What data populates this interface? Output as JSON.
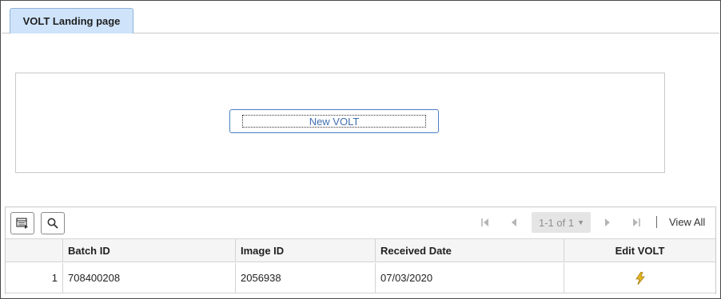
{
  "tabs": [
    {
      "label": "VOLT Landing page",
      "active": true
    }
  ],
  "actions": {
    "new_volt_label": "New VOLT"
  },
  "grid": {
    "toolbar": {
      "personalize_icon": "grid-settings-icon",
      "find_icon": "search-icon",
      "page_range": "1-1 of 1",
      "view_all_label": "View All"
    },
    "columns": [
      "",
      "Batch ID",
      "Image ID",
      "Received Date",
      "Edit VOLT"
    ],
    "rows": [
      {
        "num": "1",
        "batch_id": "708400208",
        "image_id": "2056938",
        "received_date": "07/03/2020",
        "edit_icon": "lightning-icon"
      }
    ]
  },
  "colors": {
    "accent": "#3f6fb0",
    "tab_bg": "#cfe4fb",
    "edit_icon": "#d4a017"
  }
}
